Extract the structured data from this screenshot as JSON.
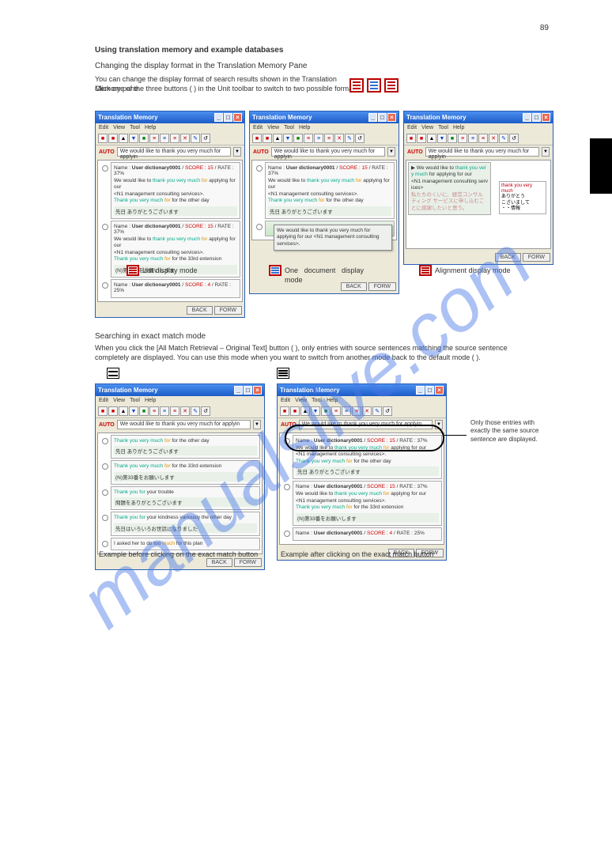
{
  "page_number": "89",
  "watermark": "manualslive.com",
  "heading1": "Using translation memory and example databases",
  "heading1_sub": "Changing the display format in the Translation Memory Pane",
  "body1a": "You can change the display format of search results shown in the Translation Memory pane.",
  "body1b": "Click one of the three buttons (          ) in the Unit toolbar to switch to two possible formats.",
  "window_title": "Translation Memory",
  "menus": [
    "Edit",
    "View",
    "Tool",
    "Help"
  ],
  "auto_label": "AUTO",
  "auto_text": "We would like to thank you very much for applyin",
  "row_name_label": "Name :",
  "row_name_value": "User dictionary0001",
  "row_score_label": "SCORE :",
  "row_rate_label": "RATE :",
  "sample_sentence_pre": "We would like to ",
  "sample_kw": "thank you very much",
  "sample_for": " for ",
  "sample_after": "applying for our",
  "sample_line2": "<N1 management consulting services>.",
  "sample_thank_line": "Thank you very much",
  "sample_other_day": " for the other day",
  "sample_jp1": "先日 ありがとうございます",
  "sample_33rd": " for the 33rd extension",
  "sample_jp_33": "(N)第33番をお願いします",
  "sample_you_for": "Thank you for ",
  "sample_trouble": "your trouble",
  "sample_jp_trouble": "問題をありがとうございます",
  "sample_kindness": "your kindness variously the other day",
  "sample_jp_kindness": "先日はいろいろお世話になりました",
  "sample_asked": "I asked her to do too ",
  "sample_much": "much",
  "sample_plan": " for this plan",
  "popup_text": "We would like to thank you very much for applying for our <N1 management consulting services>.",
  "side_header": "thank you very much",
  "side_line1": "ありがとう",
  "side_line2": "こざいまして",
  "side_line3": "・・情報",
  "side_main_jp": "私たちのくいに、経営コンサルティング サービスに申し込むことに感謝したいと思う。",
  "caption_list_mode": "List display mode",
  "caption_one_doc": "One document display mode",
  "caption_align": "Alignment display mode",
  "heading2": "Searching in exact match mode",
  "body2": "When you click the [All Match Retrieval – Original Text] button (    ), only entries with source sentences matching the source sentence completely are displayed. You can use this mode when you want to switch from another mode back to the default mode (    ).",
  "caption_ex_before": "Example before clicking on the exact match button",
  "caption_ex_after": "Example after clicking on the exact match button",
  "callout_text": "Only those entries with exactly the same source sentence are displayed.",
  "btn_back": "BACK",
  "btn_forw": "FORW",
  "score_15": "15",
  "rate_37": "37%",
  "score_4": "4",
  "rate_25": "25%"
}
